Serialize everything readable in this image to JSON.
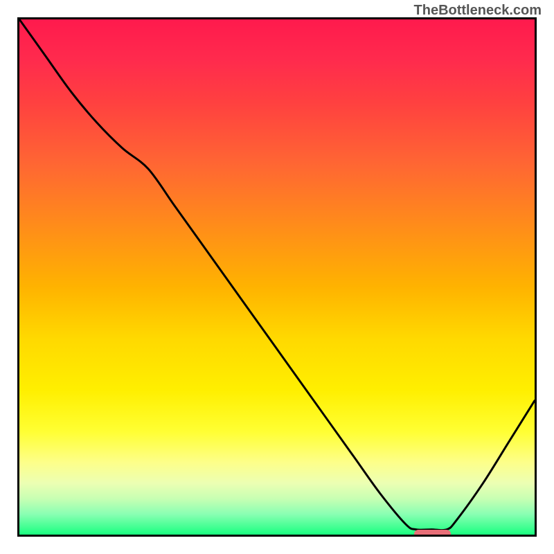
{
  "watermark": "TheBottleneck.com",
  "chart_data": {
    "type": "line",
    "title": "",
    "xlabel": "",
    "ylabel": "",
    "xlim": [
      0,
      100
    ],
    "ylim": [
      0,
      100
    ],
    "grid": false,
    "legend": false,
    "x": [
      0,
      5,
      10,
      15,
      20,
      25,
      30,
      35,
      40,
      45,
      50,
      55,
      60,
      65,
      70,
      75,
      77,
      80,
      83,
      85,
      90,
      95,
      100
    ],
    "y": [
      100,
      93,
      86,
      80,
      75,
      71,
      64,
      57,
      50,
      43,
      36,
      29,
      22,
      15,
      8,
      2,
      1,
      1,
      1,
      3,
      10,
      18,
      26
    ],
    "curve_color": "#000000",
    "optimal_marker": {
      "x_start": 76,
      "x_end": 83,
      "y": 1,
      "color": "#e86f78"
    },
    "background_gradient": {
      "type": "vertical",
      "stops": [
        {
          "pos": 0,
          "color": "#ff1a4d"
        },
        {
          "pos": 50,
          "color": "#ffb300"
        },
        {
          "pos": 80,
          "color": "#ffff33"
        },
        {
          "pos": 100,
          "color": "#1aff80"
        }
      ]
    }
  }
}
